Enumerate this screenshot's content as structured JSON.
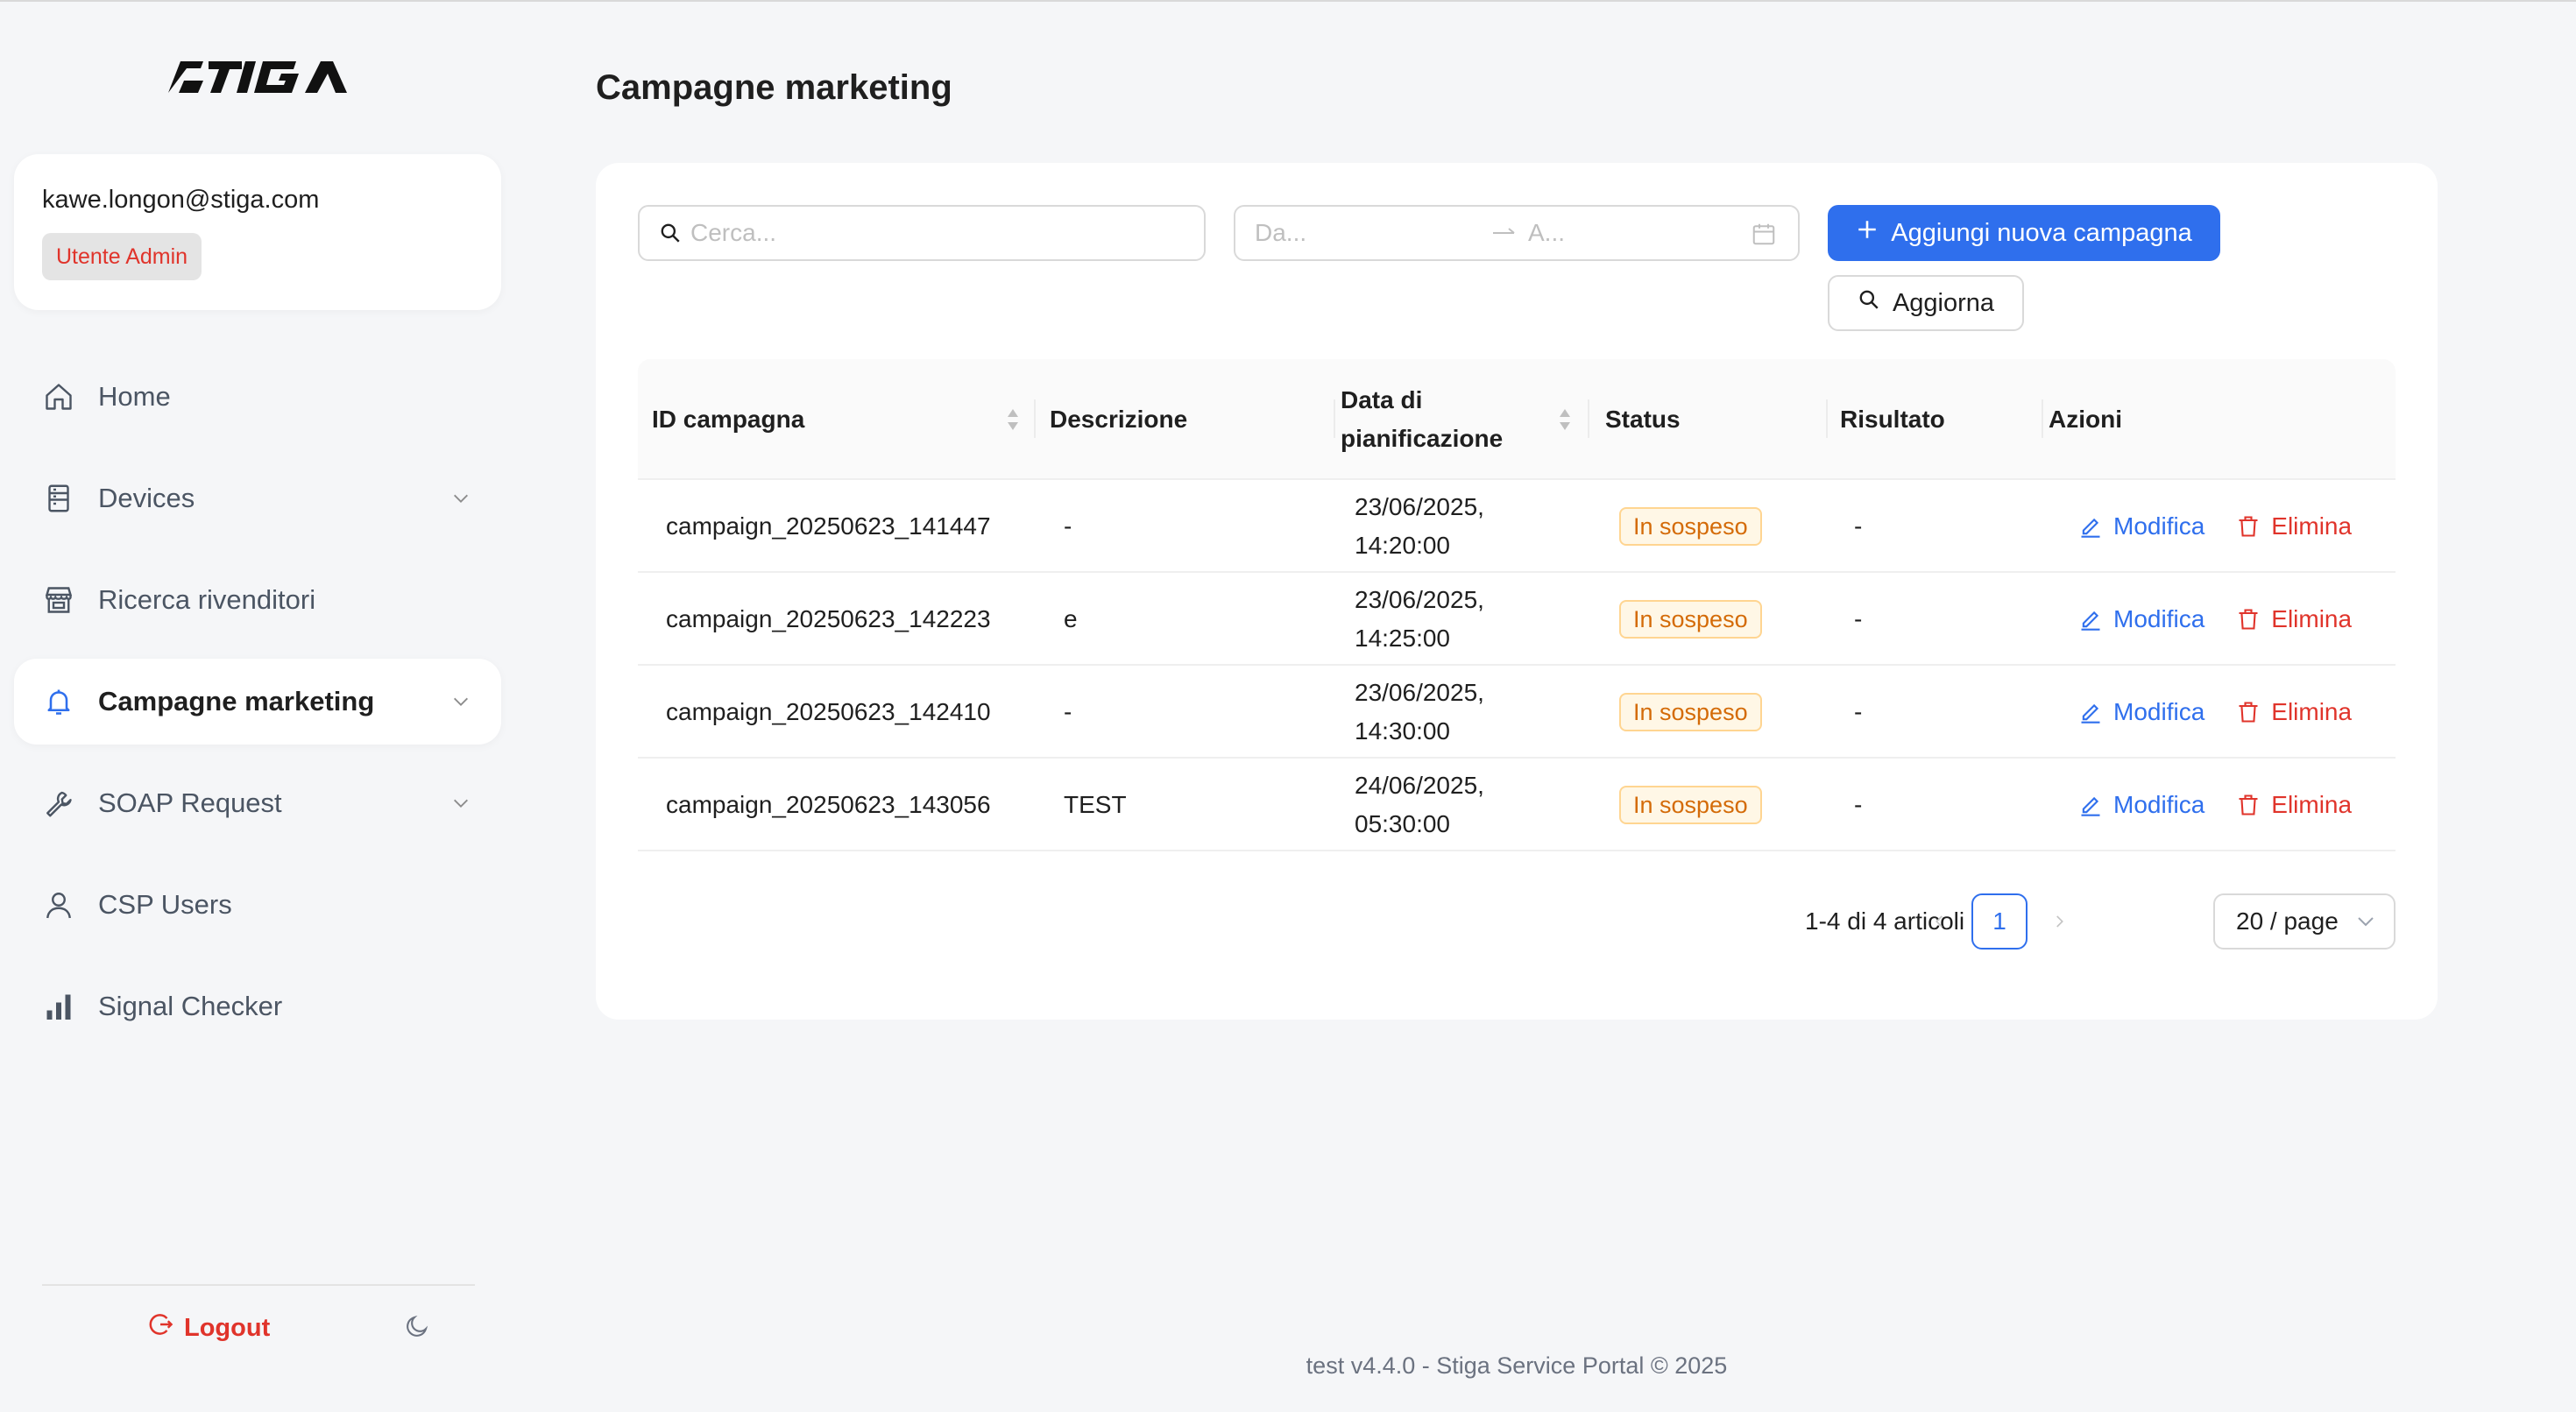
{
  "brand": {
    "logo_text": "STIGA"
  },
  "user": {
    "email": "kawe.longon@stiga.com",
    "role": "Utente Admin"
  },
  "nav": {
    "items": [
      {
        "label": "Home",
        "icon": "home-icon",
        "expandable": false,
        "active": false
      },
      {
        "label": "Devices",
        "icon": "devices-icon",
        "expandable": true,
        "active": false
      },
      {
        "label": "Ricerca rivenditori",
        "icon": "store-icon",
        "expandable": false,
        "active": false
      },
      {
        "label": "Campagne marketing",
        "icon": "bell-icon",
        "expandable": true,
        "active": true
      },
      {
        "label": "SOAP Request",
        "icon": "wrench-icon",
        "expandable": true,
        "active": false
      },
      {
        "label": "CSP Users",
        "icon": "user-icon",
        "expandable": false,
        "active": false
      },
      {
        "label": "Signal Checker",
        "icon": "signal-bars-icon",
        "expandable": false,
        "active": false
      }
    ],
    "logout_label": "Logout"
  },
  "page": {
    "title": "Campagne marketing"
  },
  "filters": {
    "search_placeholder": "Cerca...",
    "date_from_placeholder": "Da...",
    "date_to_placeholder": "A...",
    "add_button_label": "Aggiungi nuova campagna",
    "refresh_button_label": "Aggiorna"
  },
  "table": {
    "columns": {
      "id": "ID campagna",
      "description": "Descrizione",
      "date_line1": "Data di",
      "date_line2": "pianificazione",
      "status": "Status",
      "result": "Risultato",
      "actions": "Azioni"
    },
    "action_labels": {
      "edit": "Modifica",
      "delete": "Elimina"
    },
    "rows": [
      {
        "id": "campaign_20250623_141447",
        "description": "-",
        "date": "23/06/2025,",
        "time": "14:20:00",
        "status": "In sospeso",
        "result": "-"
      },
      {
        "id": "campaign_20250623_142223",
        "description": "e",
        "date": "23/06/2025,",
        "time": "14:25:00",
        "status": "In sospeso",
        "result": "-"
      },
      {
        "id": "campaign_20250623_142410",
        "description": "-",
        "date": "23/06/2025,",
        "time": "14:30:00",
        "status": "In sospeso",
        "result": "-"
      },
      {
        "id": "campaign_20250623_143056",
        "description": "TEST",
        "date": "24/06/2025,",
        "time": "05:30:00",
        "status": "In sospeso",
        "result": "-"
      }
    ]
  },
  "pagination": {
    "total_text": "1-4 di 4 articoli",
    "current_page": "1",
    "page_size": "20 / page"
  },
  "footer": {
    "text": "test v4.4.0 - Stiga Service Portal © 2025"
  },
  "colors": {
    "primary": "#2f6fed",
    "danger": "#e0342b",
    "warning_text": "#d46b08",
    "warning_bg": "#fff7e6",
    "warning_border": "#ffd591"
  }
}
